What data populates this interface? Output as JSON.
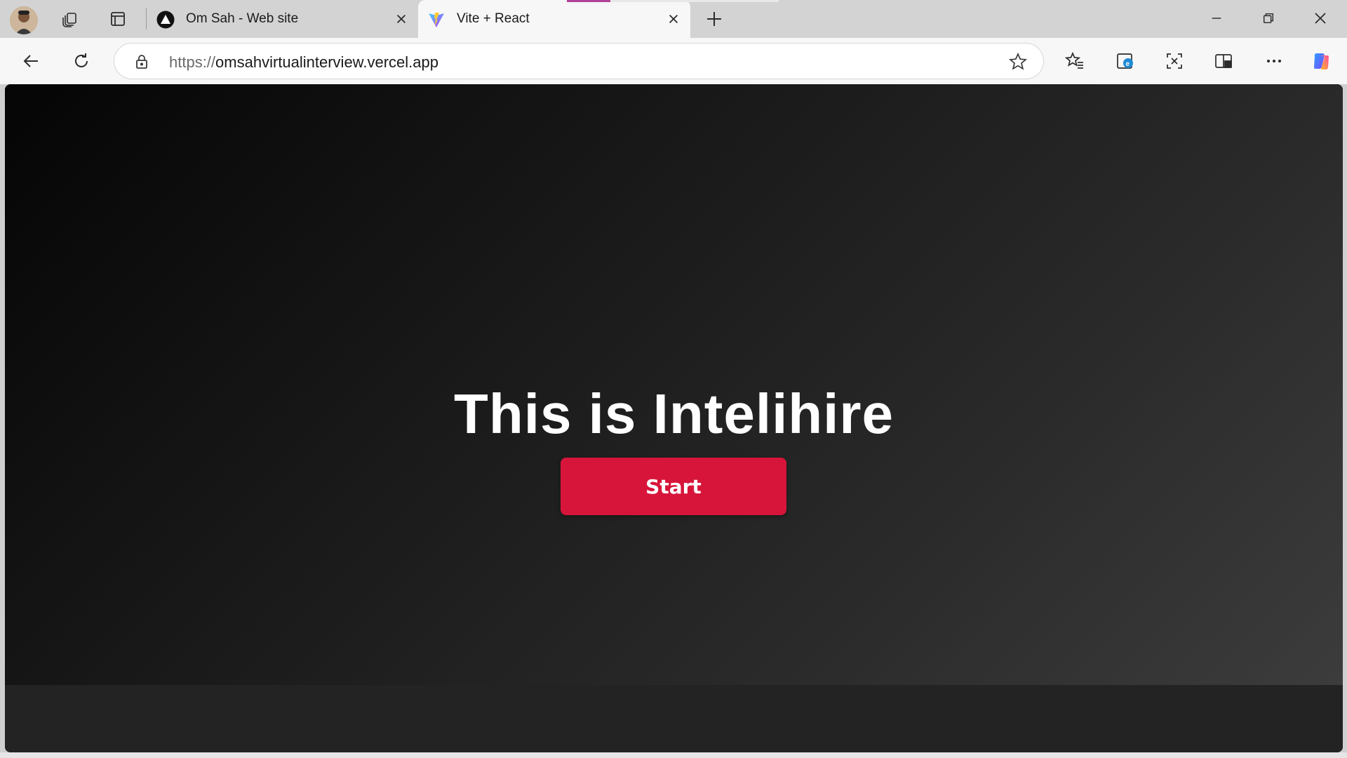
{
  "browser": {
    "tabs": [
      {
        "title": "Om Sah - Web site",
        "favicon": "triangle-logo-icon",
        "active": false
      },
      {
        "title": "Vite + React",
        "favicon": "vite-logo-icon",
        "active": true
      }
    ],
    "address": {
      "scheme": "https://",
      "host": "omsahvirtualinterview.vercel.app"
    },
    "icons": {
      "workspaces": "workspaces-icon",
      "tab_actions": "tab-actions-icon",
      "back": "back-arrow-icon",
      "refresh": "refresh-icon",
      "lock": "lock-icon",
      "favorite": "star-icon",
      "favorites": "favorites-list-icon",
      "edge_ie": "ie-mode-icon",
      "screenshot": "screenshot-icon",
      "split": "split-screen-icon",
      "more": "more-icon",
      "copilot": "copilot-icon"
    }
  },
  "page": {
    "heading": "This is Intelihire",
    "start_label": "Start",
    "colors": {
      "accent": "#d7153a",
      "background": "#1a1a1a"
    }
  }
}
